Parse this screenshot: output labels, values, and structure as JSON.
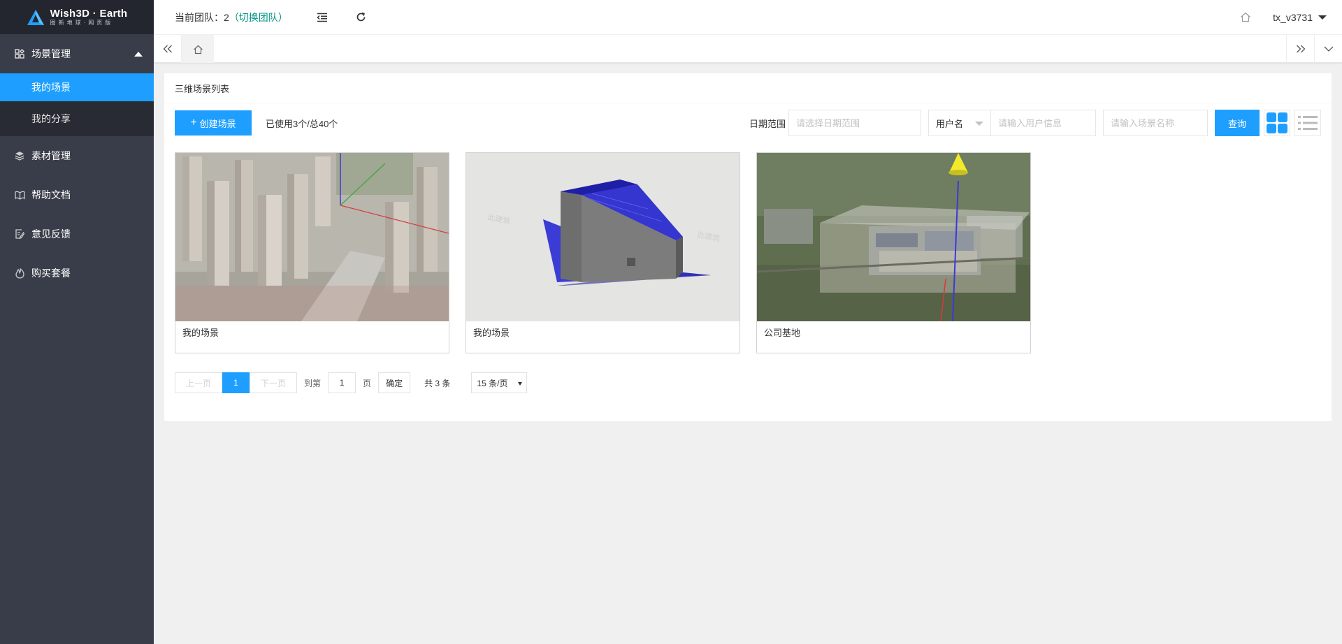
{
  "logo": {
    "title": "Wish3D · Earth",
    "subtitle": "图新地球·网页版"
  },
  "sidebar": {
    "groups": [
      {
        "label": "场景管理",
        "icon": "apps-icon",
        "children": [
          {
            "label": "我的场景",
            "active": true
          },
          {
            "label": "我的分享",
            "active": false
          }
        ]
      },
      {
        "label": "素材管理",
        "icon": "layers-icon"
      },
      {
        "label": "帮助文档",
        "icon": "book-icon"
      },
      {
        "label": "意见反馈",
        "icon": "feedback-icon"
      },
      {
        "label": "购买套餐",
        "icon": "fire-icon"
      }
    ]
  },
  "header": {
    "team_label": "当前团队：2",
    "team_switch": "（切换团队）",
    "username": "tx_v3731"
  },
  "card": {
    "title": "三维场景列表",
    "create_label": "创建场景",
    "usage": "已使用3个/总40个",
    "date_label": "日期范围",
    "date_placeholder": "请选择日期范围",
    "user_select": "用户名",
    "user_placeholder": "请输入用户信息",
    "scene_placeholder": "请输入场景名称",
    "query_label": "查询"
  },
  "scenes": [
    {
      "title": "我的场景",
      "thumb": "city-aerial"
    },
    {
      "title": "我的场景",
      "thumb": "warehouse-model"
    },
    {
      "title": "公司基地",
      "thumb": "campus-aerial"
    }
  ],
  "pagination": {
    "prev": "上一页",
    "current": "1",
    "next": "下一页",
    "goto": "到第",
    "goto_value": "1",
    "page_unit": "页",
    "confirm": "确定",
    "total": "共 3 条",
    "page_size": "15 条/页"
  },
  "colors": {
    "accent": "#1e9fff",
    "sidebar": "#393d49",
    "team_switch": "#009688"
  }
}
